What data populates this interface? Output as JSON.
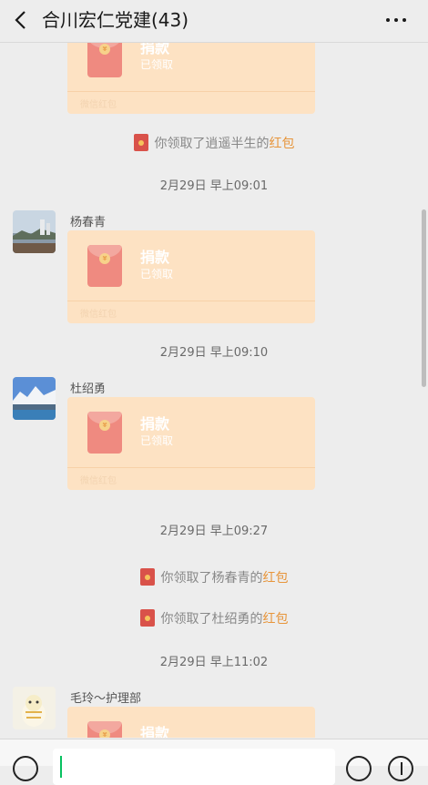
{
  "header": {
    "title": "合川宏仁党建(43)",
    "back_icon": "chevron-left-icon",
    "more_icon": "more-dots-icon"
  },
  "packets": [
    {
      "title": "捐款",
      "status": "已领取",
      "footer": "微信红包"
    },
    {
      "sender": "杨春青",
      "title": "捐款",
      "status": "已领取",
      "footer": "微信红包"
    },
    {
      "sender": "杜绍勇",
      "title": "捐款",
      "status": "已领取",
      "footer": "微信红包"
    },
    {
      "sender": "毛玲～护理部",
      "title": "捐款"
    }
  ],
  "notices": [
    {
      "prefix": "你领取了逍遥半生的",
      "link": "红包"
    },
    {
      "prefix": "你领取了杨春青的",
      "link": "红包"
    },
    {
      "prefix": "你领取了杜绍勇的",
      "link": "红包"
    }
  ],
  "times": [
    "2月29日 早上09:01",
    "2月29日 早上09:10",
    "2月29日 早上09:27",
    "2月29日 早上11:02"
  ],
  "colors": {
    "packet_bg": "#fde2c3",
    "envelope": "#ef8a80",
    "highlight": "#e7953b",
    "cursor": "#07c160",
    "background": "#ededed"
  },
  "bottom_bar": {
    "voice_icon": "voice-icon",
    "emoji_icon": "emoji-icon",
    "plus_icon": "plus-icon"
  }
}
